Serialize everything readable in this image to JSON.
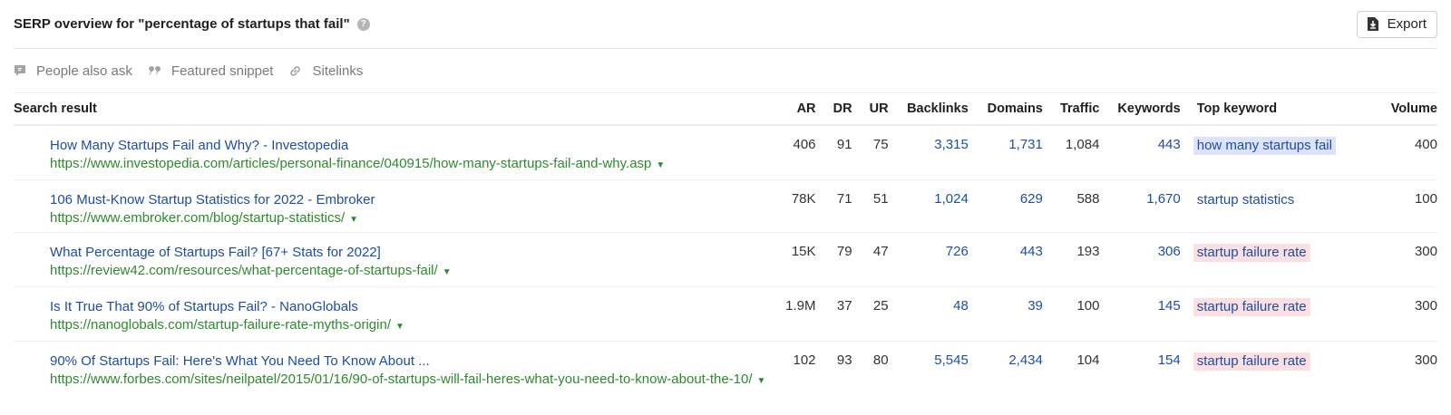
{
  "header": {
    "title": "SERP overview for \"percentage of startups that fail\"",
    "help_icon": "?",
    "export_label": "Export"
  },
  "features": [
    {
      "label": "People also ask",
      "icon": "chat-bubble-icon"
    },
    {
      "label": "Featured snippet",
      "icon": "quote-icon"
    },
    {
      "label": "Sitelinks",
      "icon": "link-icon"
    }
  ],
  "columns": {
    "result": "Search result",
    "ar": "AR",
    "dr": "DR",
    "ur": "UR",
    "backlinks": "Backlinks",
    "domains": "Domains",
    "traffic": "Traffic",
    "keywords": "Keywords",
    "top_keyword": "Top keyword",
    "volume": "Volume"
  },
  "rows": [
    {
      "title": "How Many Startups Fail and Why? - Investopedia",
      "url": "https://www.investopedia.com/articles/personal-finance/040915/how-many-startups-fail-and-why.asp",
      "ar": "406",
      "dr": "91",
      "ur": "75",
      "backlinks": "3,315",
      "domains": "1,731",
      "traffic": "1,084",
      "keywords": "443",
      "top_keyword": "how many startups fail",
      "kw_highlight": "blue",
      "volume": "400"
    },
    {
      "title": "106 Must-Know Startup Statistics for 2022 - Embroker",
      "url": "https://www.embroker.com/blog/startup-statistics/",
      "ar": "78K",
      "dr": "71",
      "ur": "51",
      "backlinks": "1,024",
      "domains": "629",
      "traffic": "588",
      "keywords": "1,670",
      "top_keyword": "startup statistics",
      "kw_highlight": "plain",
      "volume": "100"
    },
    {
      "title": "What Percentage of Startups Fail? [67+ Stats for 2022]",
      "url": "https://review42.com/resources/what-percentage-of-startups-fail/",
      "ar": "15K",
      "dr": "79",
      "ur": "47",
      "backlinks": "726",
      "domains": "443",
      "traffic": "193",
      "keywords": "306",
      "top_keyword": "startup failure rate",
      "kw_highlight": "pink",
      "volume": "300"
    },
    {
      "title": "Is It True That 90% of Startups Fail? - NanoGlobals",
      "url": "https://nanoglobals.com/startup-failure-rate-myths-origin/",
      "ar": "1.9M",
      "dr": "37",
      "ur": "25",
      "backlinks": "48",
      "domains": "39",
      "traffic": "100",
      "keywords": "145",
      "top_keyword": "startup failure rate",
      "kw_highlight": "pink",
      "volume": "300"
    },
    {
      "title": "90% Of Startups Fail: Here's What You Need To Know About ...",
      "url": "https://www.forbes.com/sites/neilpatel/2015/01/16/90-of-startups-will-fail-heres-what-you-need-to-know-about-the-10/",
      "ar": "102",
      "dr": "93",
      "ur": "80",
      "backlinks": "5,545",
      "domains": "2,434",
      "traffic": "104",
      "keywords": "154",
      "top_keyword": "startup failure rate",
      "kw_highlight": "pink",
      "volume": "300"
    }
  ],
  "colors": {
    "link": "#1d4ea3",
    "url": "#2e8a2e",
    "kw_blue": "#dee3fc",
    "kw_pink": "#fbdfe1"
  }
}
